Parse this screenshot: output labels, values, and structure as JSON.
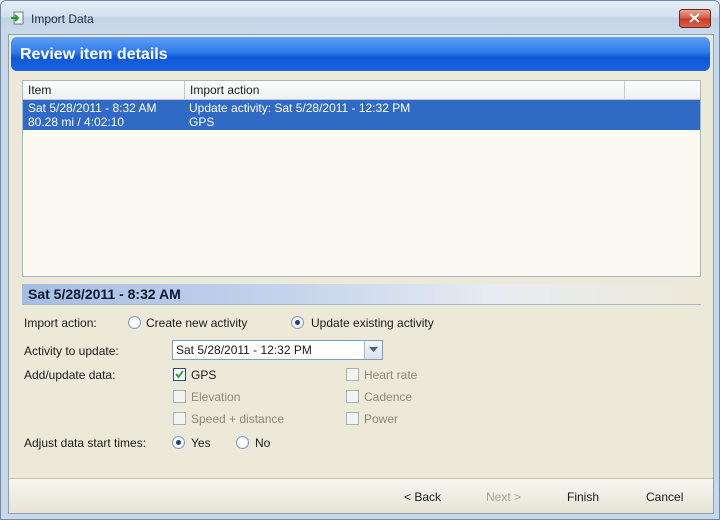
{
  "window": {
    "title": "Import Data"
  },
  "banner": {
    "title": "Review item details"
  },
  "list": {
    "columns": [
      "Item",
      "Import action"
    ],
    "rows": [
      {
        "item_line1": "Sat 5/28/2011 - 8:32 AM",
        "item_line2": "80.28 mi  /  4:02:10",
        "action_line1": "Update activity: Sat 5/28/2011 - 12:32 PM",
        "action_line2": "GPS"
      }
    ]
  },
  "details": {
    "title": "Sat 5/28/2011 - 8:32 AM",
    "import_action": {
      "label": "Import action:",
      "options": [
        "Create new activity",
        "Update existing activity"
      ],
      "selected": "Update existing activity"
    },
    "activity_to_update": {
      "label": "Activity to update:",
      "value": "Sat 5/28/2011 - 12:32 PM"
    },
    "add_update": {
      "label": "Add/update data:",
      "options": [
        {
          "label": "GPS",
          "checked": true,
          "enabled": true
        },
        {
          "label": "Heart rate",
          "checked": false,
          "enabled": false
        },
        {
          "label": "Elevation",
          "checked": false,
          "enabled": false
        },
        {
          "label": "Cadence",
          "checked": false,
          "enabled": false
        },
        {
          "label": "Speed + distance",
          "checked": false,
          "enabled": false
        },
        {
          "label": "Power",
          "checked": false,
          "enabled": false
        }
      ]
    },
    "adjust_times": {
      "label": "Adjust data start times:",
      "options": [
        "Yes",
        "No"
      ],
      "selected": "Yes"
    }
  },
  "footer": {
    "back": "< Back",
    "next": "Next >",
    "finish": "Finish",
    "cancel": "Cancel"
  },
  "colors": {
    "banner": "#1a63df",
    "selection": "#316ac5",
    "close": "#c43a22"
  }
}
